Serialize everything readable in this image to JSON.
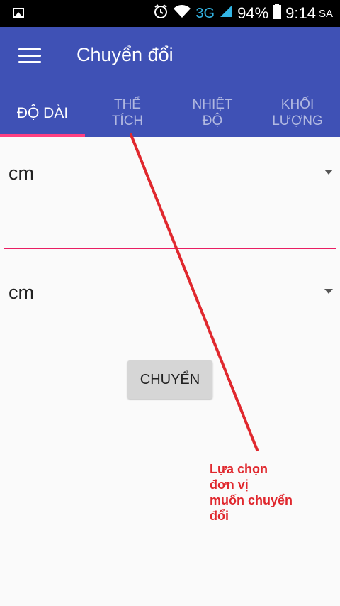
{
  "status_bar": {
    "network": "3G",
    "battery": "94%",
    "time": "9:14",
    "time_suffix": "SA"
  },
  "app_bar": {
    "title": "Chuyển đổi"
  },
  "tabs": [
    {
      "label": "ĐỘ DÀI",
      "active": true
    },
    {
      "label": "THỂ\nTÍCH",
      "active": false
    },
    {
      "label": "NHIỆT\nĐỘ",
      "active": false
    },
    {
      "label": "KHỐI\nLƯỢNG",
      "active": false
    }
  ],
  "from_unit": {
    "selected": "cm"
  },
  "input": {
    "value": ""
  },
  "to_unit": {
    "selected": "cm"
  },
  "convert_button": {
    "label": "CHUYỂN"
  },
  "annotation": {
    "text": "Lựa chọn\nđơn vị\nmuốn chuyển\nđổi",
    "color": "#e0282e"
  },
  "colors": {
    "primary": "#3f51b5",
    "accent": "#ff4081",
    "status_bar": "#000000"
  }
}
